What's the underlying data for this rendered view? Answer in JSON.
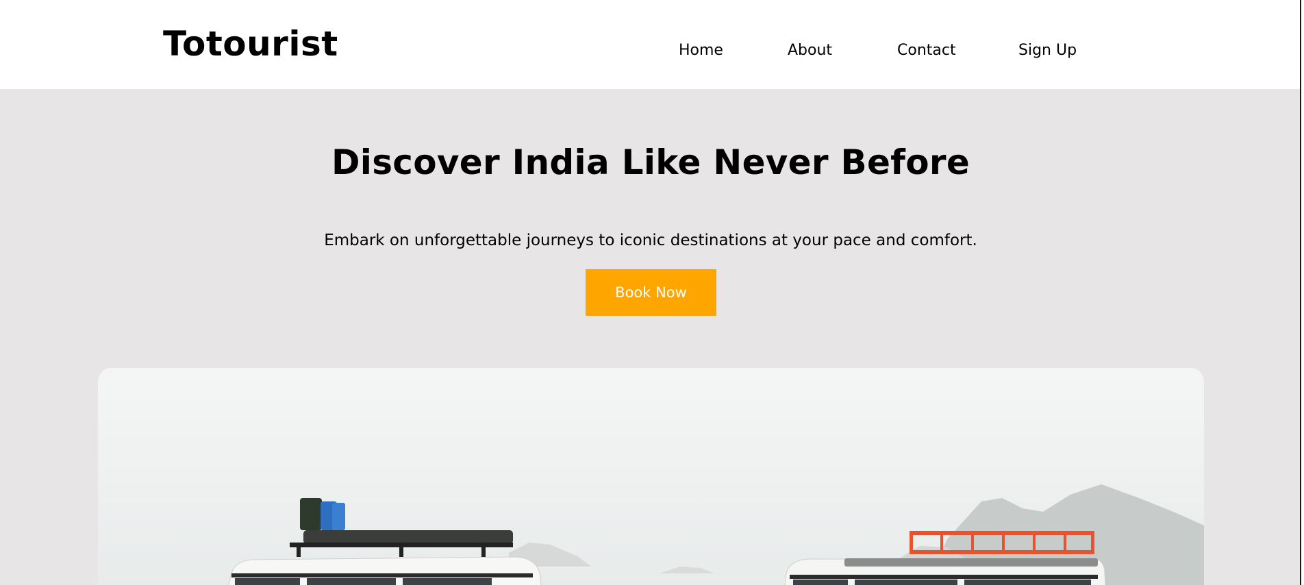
{
  "header": {
    "brand": "Totourist",
    "nav": [
      {
        "label": "Home"
      },
      {
        "label": "About"
      },
      {
        "label": "Contact"
      },
      {
        "label": "Sign Up"
      }
    ]
  },
  "hero": {
    "title": "Discover India Like Never Before",
    "subtitle": "Embark on unforgettable journeys to iconic destinations at your pace and comfort.",
    "cta_label": "Book Now"
  },
  "colors": {
    "page_background": "#e7e5e6",
    "header_background": "#ffffff",
    "cta_background": "#ffa500",
    "cta_text": "#ffffff"
  }
}
